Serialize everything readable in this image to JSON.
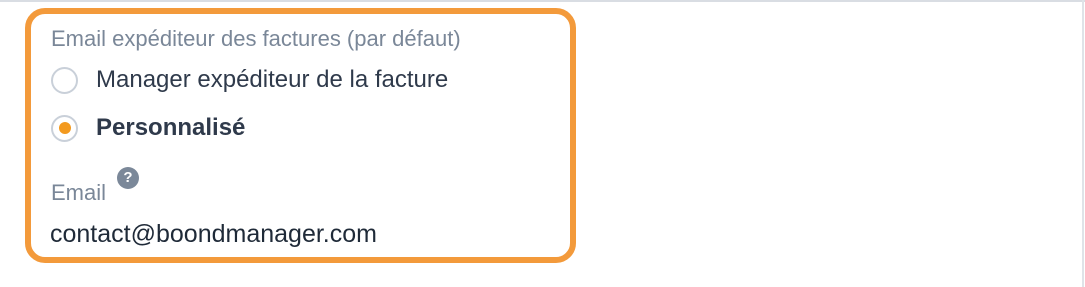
{
  "sender_section": {
    "label": "Email expéditeur des factures (par défaut)",
    "options": [
      {
        "label": "Manager expéditeur de la facture",
        "selected": false
      },
      {
        "label": "Personnalisé",
        "selected": true
      }
    ]
  },
  "email_field": {
    "label": "Email",
    "help_icon_glyph": "?",
    "value": "contact@boondmanager.com"
  },
  "colors": {
    "highlight_border": "#f39a3b",
    "radio_selected": "#f39a1f",
    "label_text": "#7a8798",
    "body_text": "#2f3a4b"
  }
}
